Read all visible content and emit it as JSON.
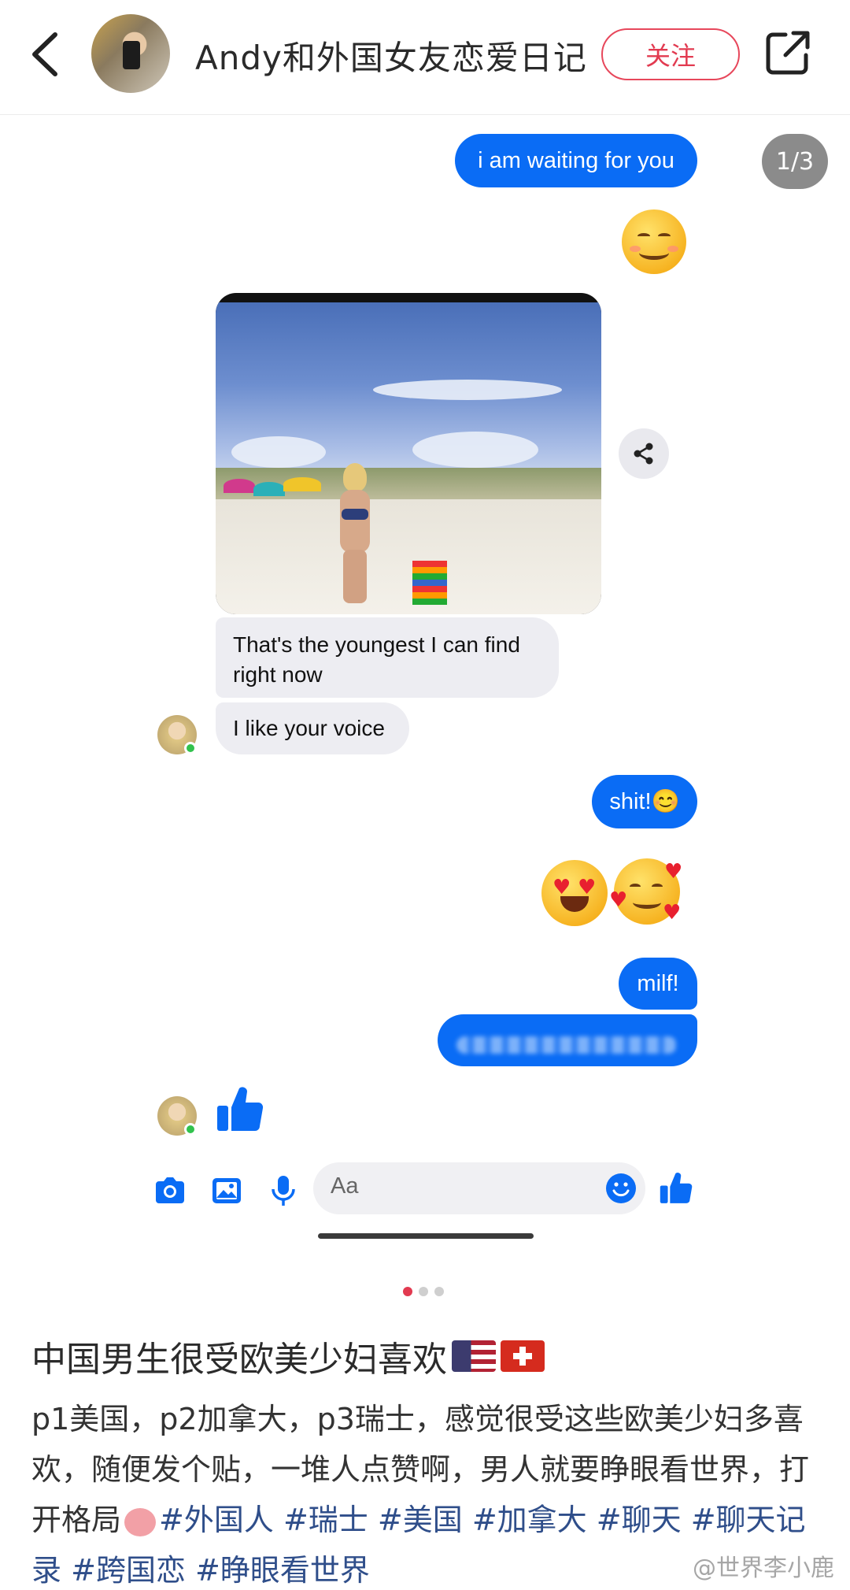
{
  "header": {
    "title": "Andy和外国女友恋爱日记",
    "follow_label": "关注"
  },
  "gallery": {
    "pager": "1/3",
    "dots_total": 3,
    "active_dot": 1
  },
  "chat": {
    "messages_out": [
      "i am waiting for you",
      "shit!😊",
      "milf!"
    ],
    "messages_in": [
      "That's the youngest I can find right now",
      "I like your voice"
    ],
    "input_placeholder": "Aa"
  },
  "post": {
    "title": "中国男生很受欧美少妇喜欢",
    "body_text": "p1美国，p2加拿大，p3瑞士，感觉很受这些欧美少妇多喜欢，随便发个贴，一堆人点赞啊，男人就要睁眼看世界，打开格局",
    "tags": [
      "#外国人",
      "#瑞士",
      "#美国",
      "#加拿大",
      "#聊天",
      "#聊天记录",
      "#跨国恋",
      "#睁眼看世界"
    ],
    "watermark": "@世界李小鹿"
  },
  "icons": {
    "back": "chevron-left-icon",
    "share_out": "external-share-icon",
    "share": "share-icon",
    "camera": "camera-icon",
    "image": "image-icon",
    "mic": "microphone-icon",
    "emoji": "emoji-icon",
    "like": "thumbs-up-icon"
  },
  "colors": {
    "messenger_blue": "#0a6cf5",
    "follow_red": "#e23a50",
    "incoming_bubble": "#ededf2",
    "tag_blue": "#2f4e8a"
  }
}
